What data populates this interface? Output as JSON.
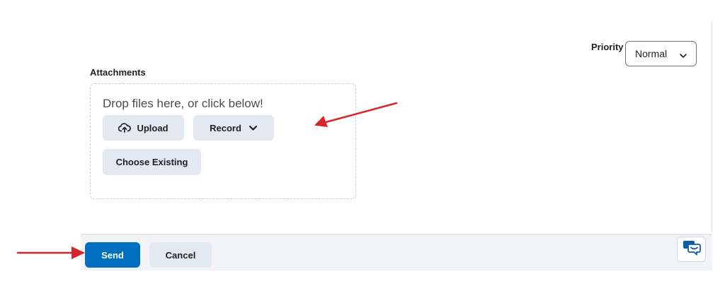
{
  "priority": {
    "label": "Priority",
    "selected": "Normal"
  },
  "attachments": {
    "label": "Attachments",
    "drop_text": "Drop files here, or click below!",
    "upload_label": "Upload",
    "record_label": "Record",
    "choose_existing_label": "Choose Existing"
  },
  "footer": {
    "send_label": "Send",
    "cancel_label": "Cancel"
  },
  "icons": {
    "upload": "cloud-upload-icon",
    "record_dropdown": "chevron-down-icon",
    "priority_dropdown": "chevron-down-icon",
    "chat": "chat-bubble-icon"
  },
  "colors": {
    "primary": "#006fbf",
    "secondary_button": "#e3e9f1",
    "annotation_arrow": "#d7262b"
  }
}
